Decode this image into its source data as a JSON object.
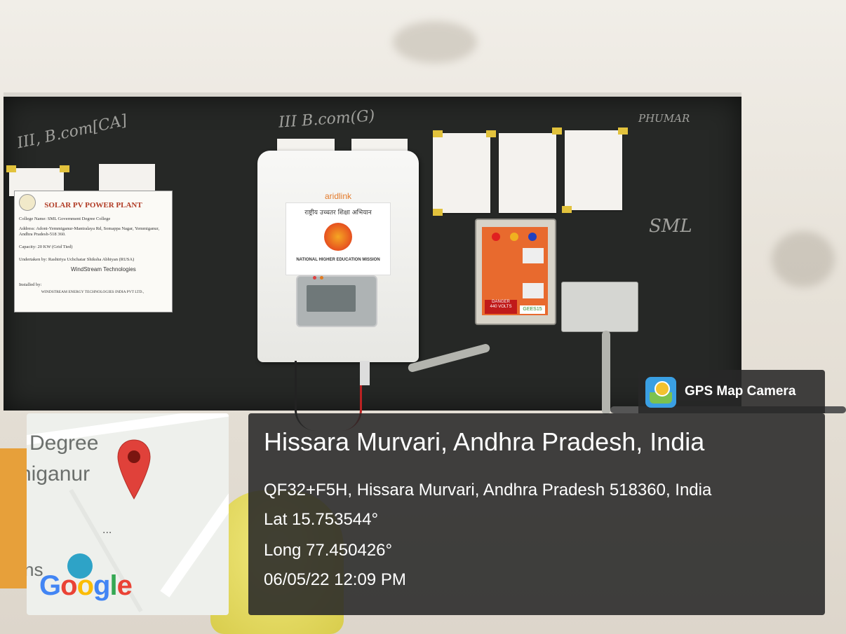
{
  "overlay": {
    "place": "Hissara Murvari, Andhra Pradesh, India",
    "address": "QF32+F5H, Hissara Murvari, Andhra Pradesh 518360, India",
    "lat": "Lat 15.753544°",
    "long": "Long 77.450426°",
    "datetime": "06/05/22 12:09 PM"
  },
  "badge": {
    "label": "GPS Map Camera",
    "icon": "map-camera-icon"
  },
  "map": {
    "label_degree": "Degree",
    "label_town": "niganur",
    "label_ns": "ns",
    "more": "...",
    "google": [
      "G",
      "o",
      "o",
      "g",
      "l",
      "e"
    ],
    "google_colors": [
      "#4285F4",
      "#EA4335",
      "#FBBC05",
      "#4285F4",
      "#34A853",
      "#EA4335"
    ],
    "pin_icon": "map-pin-icon"
  },
  "board": {
    "chalk_left": "III, B.com[CA]",
    "chalk_mid": "III B.com(G)",
    "chalk_right_top": "PHUMAR",
    "chalk_right_mid": "SML"
  },
  "poster": {
    "title": "SOLAR PV POWER PLANT",
    "college": "College Name: SML Government Degree College",
    "address": "Address: Adoni-Yemmiganur-Mantralaya Rd, Somappa Nagar, Yemmiganur, Andhra Pradesh-518 360.",
    "capacity": "Capacity: 20 KW (Grid Tied)",
    "undertaken": "Undertaken by: Rashtriya Uchchatar Shiksha Abhiyan (RUSA)",
    "windstream": "WindStream Technologies",
    "installed": "Installed by:",
    "company": "WINDSTREAM ENERGY TECHNOLOGIES INDIA PVT LTD.,"
  },
  "inverter": {
    "brand": "aridlink",
    "mission_hindi": "राष्ट्रीय उच्चतर शिक्षा अभियान",
    "mission_en": "NATIONAL HIGHER EDUCATION MISSION"
  },
  "dbox": {
    "danger": "DANGER",
    "volts": "440 VOLTS",
    "maker": "GEES15"
  }
}
